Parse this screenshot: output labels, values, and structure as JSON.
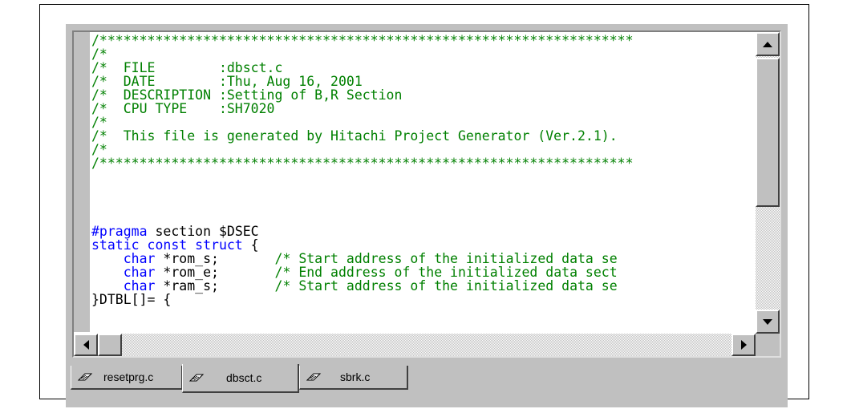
{
  "editor": {
    "lines": [
      [
        {
          "t": "/*******************************************************************",
          "c": "c"
        }
      ],
      [
        {
          "t": "/*",
          "c": "c"
        }
      ],
      [
        {
          "t": "/*  FILE        :dbsct.c",
          "c": "c"
        }
      ],
      [
        {
          "t": "/*  DATE        :Thu, Aug 16, 2001",
          "c": "c"
        }
      ],
      [
        {
          "t": "/*  DESCRIPTION :Setting of B,R Section",
          "c": "c"
        }
      ],
      [
        {
          "t": "/*  CPU TYPE    :SH7020",
          "c": "c"
        }
      ],
      [
        {
          "t": "/*",
          "c": "c"
        }
      ],
      [
        {
          "t": "/*  This file is generated by Hitachi Project Generator (Ver.2.1).",
          "c": "c"
        }
      ],
      [
        {
          "t": "/*",
          "c": "c"
        }
      ],
      [
        {
          "t": "/*******************************************************************",
          "c": "c"
        }
      ],
      [
        {
          "t": "",
          "c": ""
        }
      ],
      [
        {
          "t": "",
          "c": ""
        }
      ],
      [
        {
          "t": "",
          "c": ""
        }
      ],
      [
        {
          "t": "",
          "c": ""
        }
      ],
      [
        {
          "t": "#pragma",
          "c": "k"
        },
        {
          "t": " section $DSEC",
          "c": ""
        }
      ],
      [
        {
          "t": "static const struct",
          "c": "k"
        },
        {
          "t": " {",
          "c": ""
        }
      ],
      [
        {
          "t": "    ",
          "c": ""
        },
        {
          "t": "char",
          "c": "k"
        },
        {
          "t": " *rom_s;       ",
          "c": ""
        },
        {
          "t": "/* Start address of the initialized data se",
          "c": "c"
        }
      ],
      [
        {
          "t": "    ",
          "c": ""
        },
        {
          "t": "char",
          "c": "k"
        },
        {
          "t": " *rom_e;       ",
          "c": ""
        },
        {
          "t": "/* End address of the initialized data sect",
          "c": "c"
        }
      ],
      [
        {
          "t": "    ",
          "c": ""
        },
        {
          "t": "char",
          "c": "k"
        },
        {
          "t": " *ram_s;       ",
          "c": ""
        },
        {
          "t": "/* Start address of the initialized data se",
          "c": "c"
        }
      ],
      [
        {
          "t": "}DTBL[]= {",
          "c": ""
        }
      ]
    ]
  },
  "tabs": [
    {
      "label": "resetprg.c",
      "active": false
    },
    {
      "label": "dbsct.c",
      "active": true
    },
    {
      "label": "sbrk.c",
      "active": false
    }
  ],
  "colors": {
    "comment": "#008000",
    "keyword": "#0000ff",
    "chrome": "#c0c0c0"
  }
}
